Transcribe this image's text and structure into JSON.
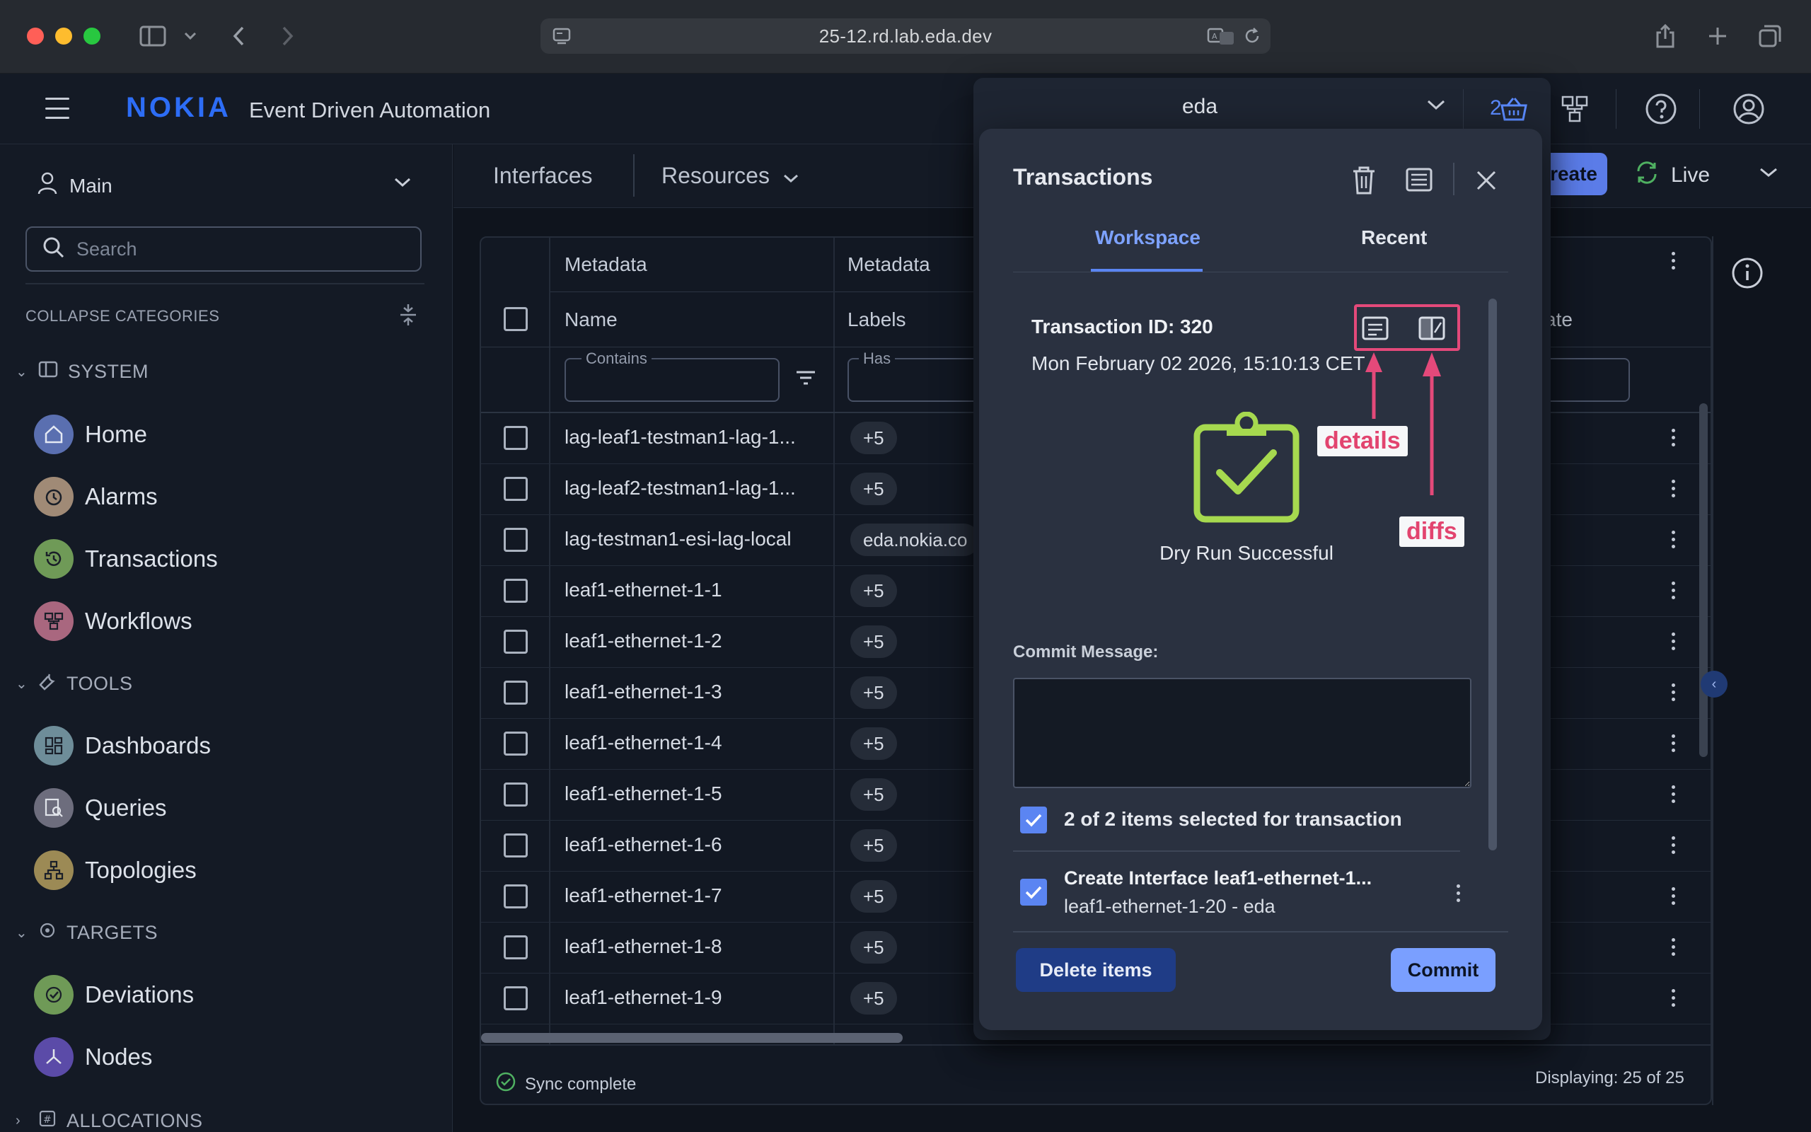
{
  "browser": {
    "url": "25-12.rd.lab.eda.dev"
  },
  "header": {
    "brand": "NOKIA",
    "app_title": "Event Driven Automation",
    "basket_count": "2",
    "namespace": "eda"
  },
  "sidebar": {
    "workspace": "Main",
    "search_placeholder": "Search",
    "collapse_label": "COLLAPSE CATEGORIES",
    "categories": {
      "system": "SYSTEM",
      "tools": "TOOLS",
      "targets": "TARGETS",
      "allocations": "ALLOCATIONS"
    },
    "items": {
      "home": "Home",
      "alarms": "Alarms",
      "transactions": "Transactions",
      "workflows": "Workflows",
      "dashboards": "Dashboards",
      "queries": "Queries",
      "topologies": "Topologies",
      "deviations": "Deviations",
      "nodes": "Nodes"
    },
    "colors": {
      "home": "#5a6fb0",
      "alarms": "#a08a76",
      "transactions": "#6f9a57",
      "workflows": "#a9677f",
      "dashboards": "#6e8d99",
      "queries": "#6d6d7d",
      "topologies": "#9c8a55",
      "deviations": "#6f9a57",
      "nodes": "#5b4ba8"
    }
  },
  "content": {
    "tabs": {
      "interfaces": "Interfaces",
      "resources": "Resources"
    },
    "create_label": "reate",
    "live_label": "Live"
  },
  "table": {
    "group_headers": [
      "Metadata",
      "Metadata"
    ],
    "col_name": "Name",
    "col_labels": "Labels",
    "col_state": "ate",
    "filter_contains": "Contains",
    "filter_has": "Has",
    "rows": [
      {
        "name": "lag-leaf1-testman1-lag-1...",
        "label": "+5"
      },
      {
        "name": "lag-leaf2-testman1-lag-1...",
        "label": "+5"
      },
      {
        "name": "lag-testman1-esi-lag-local",
        "label": "eda.nokia.co"
      },
      {
        "name": "leaf1-ethernet-1-1",
        "label": "+5"
      },
      {
        "name": "leaf1-ethernet-1-2",
        "label": "+5"
      },
      {
        "name": "leaf1-ethernet-1-3",
        "label": "+5"
      },
      {
        "name": "leaf1-ethernet-1-4",
        "label": "+5"
      },
      {
        "name": "leaf1-ethernet-1-5",
        "label": "+5"
      },
      {
        "name": "leaf1-ethernet-1-6",
        "label": "+5"
      },
      {
        "name": "leaf1-ethernet-1-7",
        "label": "+5"
      },
      {
        "name": "leaf1-ethernet-1-8",
        "label": "+5"
      },
      {
        "name": "leaf1-ethernet-1-9",
        "label": "+5"
      }
    ],
    "sync_status": "Sync complete",
    "displaying": "Displaying: 25 of 25"
  },
  "dialog": {
    "title": "Transactions",
    "tab_workspace": "Workspace",
    "tab_recent": "Recent",
    "transaction_id": "Transaction ID: 320",
    "transaction_date": "Mon February 02 2026, 15:10:13 CET",
    "dry_run_status": "Dry Run Successful",
    "callout_details": "details",
    "callout_diffs": "diffs",
    "commit_label": "Commit Message:",
    "commit_value": "",
    "selected_text": "2 of 2 items selected for transaction",
    "item_title": "Create Interface leaf1-ethernet-1...",
    "item_sub": "leaf1-ethernet-1-20 - eda",
    "delete_button": "Delete items",
    "commit_button": "Commit",
    "colors": {
      "accent": "#5b85f2",
      "success": "#a6d94f",
      "callout": "#e4497a"
    }
  }
}
